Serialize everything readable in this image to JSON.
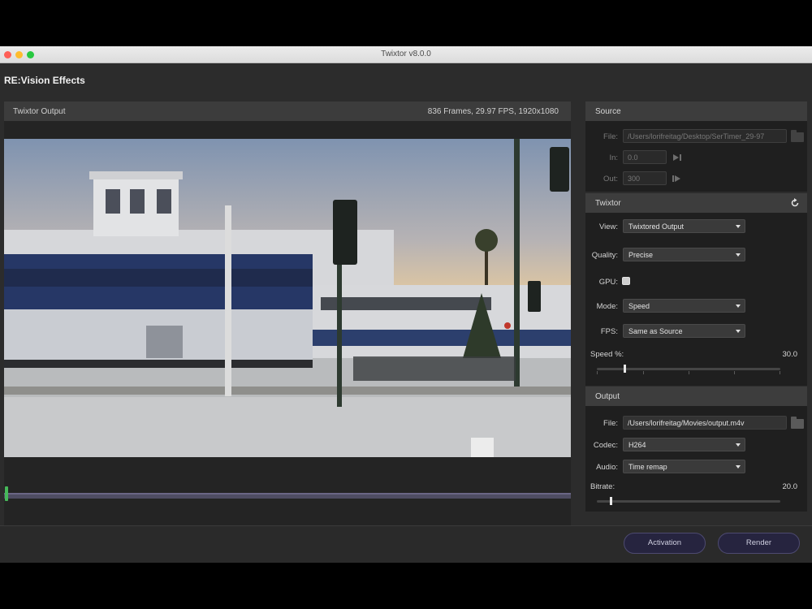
{
  "window": {
    "title": "Twixtor v8.0.0"
  },
  "brand": "RE:Vision Effects",
  "output_panel": {
    "title": "Twixtor Output",
    "info": "836 Frames, 29.97 FPS, 1920x1080",
    "scrub_position": 0.0
  },
  "source": {
    "title": "Source",
    "file_label": "File:",
    "file_value": "/Users/lorifreitag/Desktop/SerTimer_29-97",
    "in_label": "In:",
    "in_value": "0.0",
    "out_label": "Out:",
    "out_value": "300"
  },
  "twixtor": {
    "title": "Twixtor",
    "view_label": "View:",
    "view_value": "Twixtored Output",
    "quality_label": "Quality:",
    "quality_value": "Precise",
    "gpu_label": "GPU:",
    "mode_label": "Mode:",
    "mode_value": "Speed",
    "fps_label": "FPS:",
    "fps_value": "Same as Source",
    "speed_label": "Speed %:",
    "speed_value": "30.0"
  },
  "output": {
    "title": "Output",
    "file_label": "File:",
    "file_value": "/Users/lorifreitag/Movies/output.m4v",
    "codec_label": "Codec:",
    "codec_value": "H264",
    "audio_label": "Audio:",
    "audio_value": "Time remap",
    "bitrate_label": "Bitrate:",
    "bitrate_value": "20.0"
  },
  "buttons": {
    "activation": "Activation",
    "render": "Render"
  },
  "icons": {
    "in_icon": "set-in-point-icon",
    "out_icon": "set-out-point-icon",
    "reset_icon": "reset-icon",
    "folder_icon": "folder-icon"
  },
  "colors": {
    "window_bg": "#2c2c2c",
    "button_bg": "#26243f",
    "scrub": "#4f4d63",
    "handle": "#46b85a"
  }
}
